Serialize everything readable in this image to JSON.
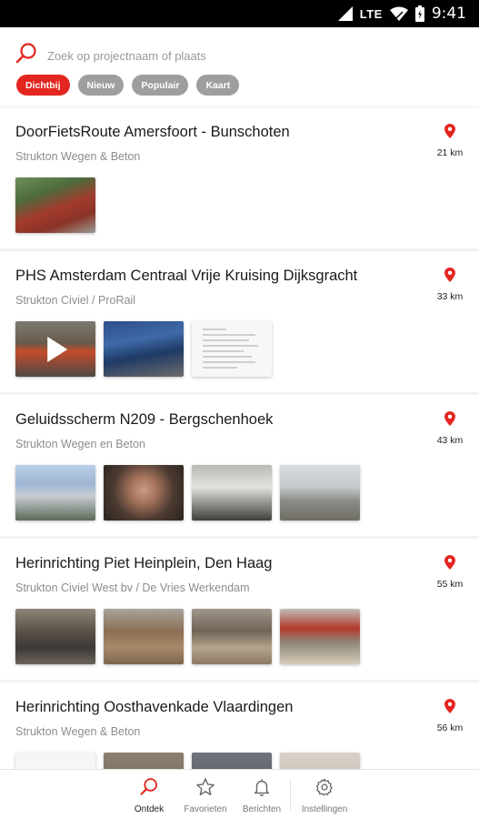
{
  "status_bar": {
    "network": "LTE",
    "time": "9:41"
  },
  "search": {
    "placeholder": "Zoek op projectnaam of plaats"
  },
  "filters": [
    {
      "label": "Dichtbij",
      "active": true
    },
    {
      "label": "Nieuw",
      "active": false
    },
    {
      "label": "Populair",
      "active": false
    },
    {
      "label": "Kaart",
      "active": false
    }
  ],
  "projects": [
    {
      "title": "DoorFietsRoute Amersfoort - Bunschoten",
      "company": "Strukton Wegen & Beton",
      "distance": "21 km"
    },
    {
      "title": "PHS Amsterdam Centraal Vrije Kruising Dijksgracht",
      "company": "Strukton Civiel / ProRail",
      "distance": "33 km"
    },
    {
      "title": "Geluidsscherm N209 - Bergschenhoek",
      "company": "Strukton Wegen en Beton",
      "distance": "43 km"
    },
    {
      "title": "Herinrichting Piet Heinplein, Den Haag",
      "company": "Strukton Civiel West bv / De Vries Werkendam",
      "distance": "55 km"
    },
    {
      "title": "Herinrichting Oosthavenkade Vlaardingen",
      "company": "Strukton Wegen & Beton",
      "distance": "56 km"
    }
  ],
  "nav": [
    {
      "label": "Ontdek",
      "icon": "search-icon",
      "active": true
    },
    {
      "label": "Favorieten",
      "icon": "star-icon",
      "active": false
    },
    {
      "label": "Berichten",
      "icon": "bell-icon",
      "active": false
    },
    {
      "label": "Instellingen",
      "icon": "gear-icon",
      "active": false
    }
  ],
  "colors": {
    "accent": "#e3261f",
    "chip_inactive": "#9e9e9e",
    "status_bar": "#000000"
  }
}
